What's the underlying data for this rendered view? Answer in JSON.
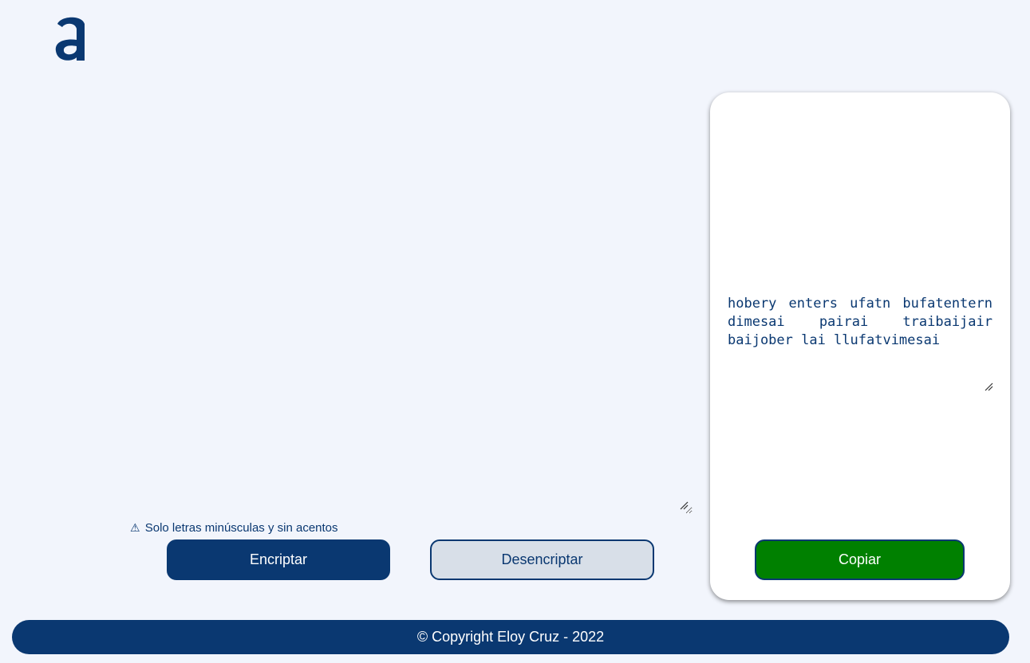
{
  "logo": {
    "icon": "alura-logo-icon",
    "color": "#0a3871"
  },
  "input": {
    "value": "",
    "placeholder": ""
  },
  "warning": {
    "icon": "⚠",
    "text": "Solo letras minúsculas y sin acentos"
  },
  "buttons": {
    "encrypt_label": "Encriptar",
    "decrypt_label": "Desencriptar",
    "copy_label": "Copiar"
  },
  "output": {
    "text": "hobery enters ufatn bufatentern dimesai pairai traibaijair baijober lai llufatvimesai"
  },
  "footer": {
    "text": "© Copyright Eloy Cruz - 2022"
  },
  "colors": {
    "primary": "#0a3871",
    "background": "#f2f5fc",
    "decrypt_bg": "#d8dfe8",
    "copy_bg": "#008000",
    "panel_bg": "#ffffff"
  }
}
